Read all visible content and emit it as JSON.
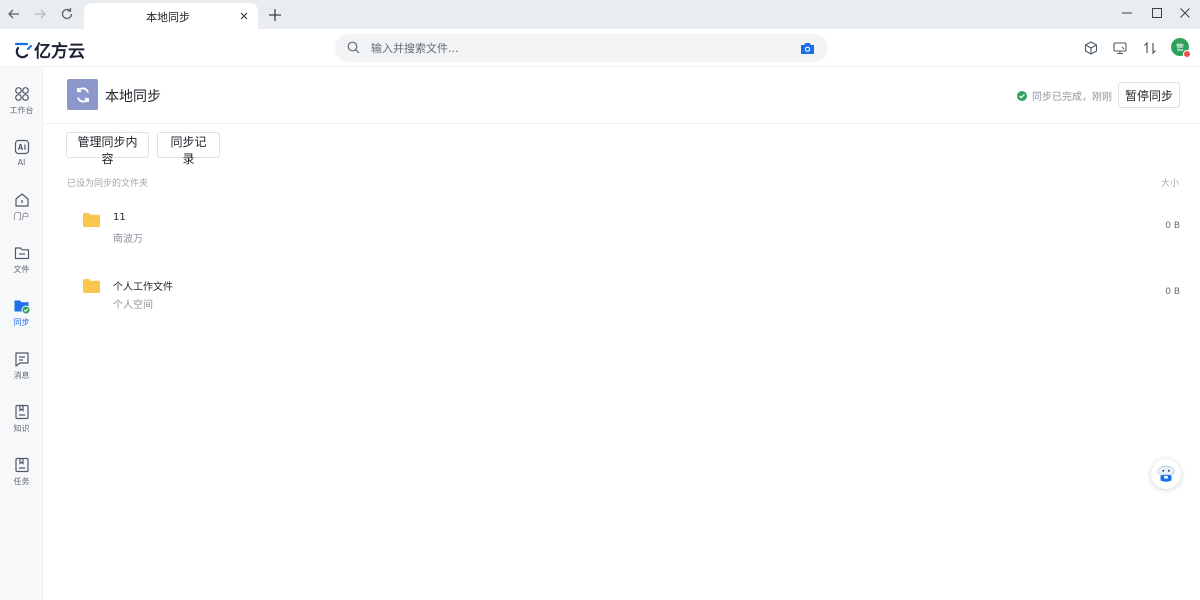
{
  "browser": {
    "tab_title": "本地同步"
  },
  "header": {
    "logo_text": "亿方云",
    "search_placeholder": "输入并搜索文件...",
    "avatar_text": "管"
  },
  "sidebar": {
    "items": [
      {
        "label": "工作台",
        "icon": "grid-icon"
      },
      {
        "label": "AI",
        "icon": "ai-icon"
      },
      {
        "label": "门户",
        "icon": "home-icon"
      },
      {
        "label": "文件",
        "icon": "folder-icon"
      },
      {
        "label": "同步",
        "icon": "sync-folder-icon",
        "active": true
      },
      {
        "label": "消息",
        "icon": "message-icon"
      },
      {
        "label": "知识",
        "icon": "book-icon"
      },
      {
        "label": "任务",
        "icon": "task-icon"
      }
    ]
  },
  "main": {
    "title": "本地同步",
    "status_text": "同步已完成，刚刚",
    "pause_button": "暂停同步",
    "manage_button": "管理同步内容",
    "record_button": "同步记录",
    "section_label": "已设为同步的文件夹",
    "size_header": "大小",
    "folders": [
      {
        "name": "11",
        "owner": "南波万",
        "size": "0 B"
      },
      {
        "name": "个人工作文件",
        "owner": "个人空间",
        "size": "0 B"
      }
    ]
  },
  "colors": {
    "accent": "#1d6fe8",
    "status_green": "#2fa35d",
    "folder_yellow": "#f9c74f"
  }
}
